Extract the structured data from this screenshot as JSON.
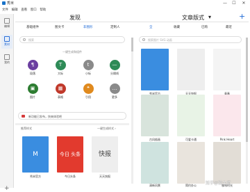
{
  "window": {
    "title": "秀米",
    "minimize": "—",
    "maximize": "☐",
    "close": "✕"
  },
  "menu": [
    "文件",
    "编辑",
    "查看",
    "窗口",
    "帮助"
  ],
  "nav": [
    {
      "label": "编辑"
    },
    {
      "label": "素材"
    },
    {
      "label": "我的"
    }
  ],
  "toolbar": {
    "title": "发现",
    "dropdown": "文章版式",
    "dropdown_arrow": "▾",
    "plus": "+",
    "left_tabs": [
      "基础组件",
      "图文卡",
      "非图形",
      "定制人"
    ],
    "right_tabs": [
      "全",
      "收藏",
      "已购",
      "最近"
    ]
  },
  "left": {
    "search_placeholder": "搜索",
    "section_label": "一键生成和组件",
    "components": [
      {
        "label": "段落",
        "color": "#6b3fa0",
        "icon": "¶"
      },
      {
        "label": "大标",
        "color": "#2e8b57",
        "icon": "T"
      },
      {
        "label": "小标",
        "color": "#8a8a8a",
        "icon": "t"
      },
      {
        "label": "分隔线",
        "color": "#2e8b57",
        "icon": "—"
      },
      {
        "label": "图片",
        "color": "#2e7d32",
        "icon": "▣"
      },
      {
        "label": "表格",
        "color": "#c0392b",
        "icon": "▦"
      },
      {
        "label": "引用",
        "color": "#e08a1e",
        "icon": "❝"
      },
      {
        "label": "更多",
        "color": "#8a8a8a",
        "icon": "…"
      }
    ],
    "notice": "新功能已发布，快来体验吧",
    "templates_header": "推荐样式",
    "templates_header_right": "一键生成样式 ›",
    "templates": [
      {
        "label": "秀米官方",
        "bg": "#3a8de0",
        "text": "M"
      },
      {
        "label": "今日头条",
        "bg": "#e23a2e",
        "text": "今日\n头条"
      },
      {
        "label": "天天快报",
        "bg": "#eeeeee",
        "text": "快报"
      }
    ]
  },
  "right": {
    "search_placeholder": "搜索图片 SVG 动画",
    "items": [
      {
        "label": "秀米官方",
        "bg": "#3a8de0"
      },
      {
        "label": "天天快报",
        "bg": "#eeeeee"
      },
      {
        "label": "青春",
        "bg": "#f4f4f4"
      },
      {
        "label": "古风插画",
        "bg": "#d8e4dc"
      },
      {
        "label": "可爱卡通",
        "bg": "#e8f3e6"
      },
      {
        "label": "Pink Heart",
        "bg": "#fbe7ec"
      },
      {
        "label": "清新风景",
        "bg": "#cfe3df"
      },
      {
        "label": "简约办公",
        "bg": "#e9e4dd"
      },
      {
        "label": "咖啡时光",
        "bg": "#e2ddd6"
      }
    ],
    "watermark": "知乎@猫大师"
  }
}
